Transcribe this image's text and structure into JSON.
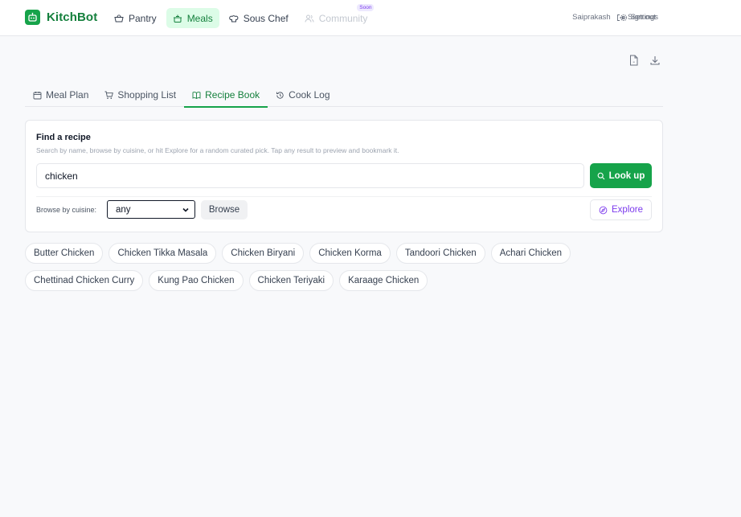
{
  "app": {
    "name": "KitchBot"
  },
  "nav": {
    "items": [
      {
        "label": "Pantry",
        "icon": "basket-icon"
      },
      {
        "label": "Meals",
        "icon": "pot-icon",
        "active": true
      },
      {
        "label": "Sous Chef",
        "icon": "chef-hat-icon"
      },
      {
        "label": "Community",
        "icon": "users-icon",
        "disabled": true,
        "badge": "Soon"
      }
    ],
    "username": "Saiprakash",
    "settings_label": "Settings",
    "signout_label": "Sign out"
  },
  "tabs": [
    {
      "label": "Meal Plan",
      "icon": "calendar-icon"
    },
    {
      "label": "Shopping List",
      "icon": "cart-icon"
    },
    {
      "label": "Recipe Book",
      "icon": "book-icon",
      "active": true
    },
    {
      "label": "Cook Log",
      "icon": "history-icon"
    }
  ],
  "finder": {
    "title": "Find a recipe",
    "subtitle": "Search by name, browse by cuisine, or hit Explore for a random curated pick. Tap any result to preview and bookmark it.",
    "search_value": "chicken",
    "lookup_label": "Look up",
    "browse_label": "Browse by cuisine:",
    "cuisine_value": "any",
    "browse_button": "Browse",
    "explore_label": "Explore"
  },
  "results": [
    "Butter Chicken",
    "Chicken Tikka Masala",
    "Chicken Biryani",
    "Chicken Korma",
    "Tandoori Chicken",
    "Achari Chicken",
    "Chettinad Chicken Curry",
    "Kung Pao Chicken",
    "Chicken Teriyaki",
    "Karaage Chicken"
  ],
  "colors": {
    "brand": "#16a34a",
    "accent_purple": "#7c3aed"
  }
}
